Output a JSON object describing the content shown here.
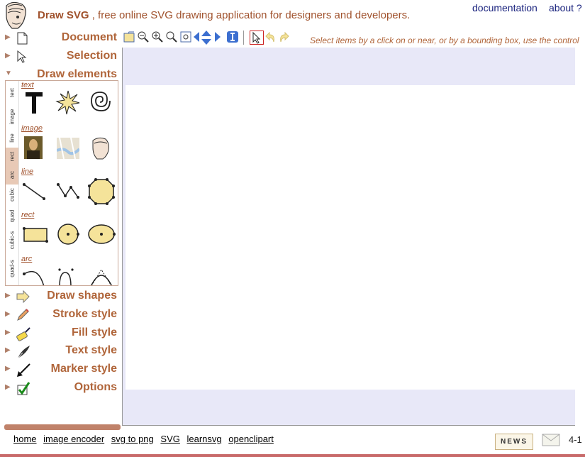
{
  "header": {
    "app_name": "Draw SVG",
    "tagline": ", free online SVG drawing application for designers and developers.",
    "links": [
      "documentation",
      "about ?"
    ]
  },
  "accordion": [
    {
      "label": "Document",
      "icon": "document-icon",
      "expanded": false
    },
    {
      "label": "Selection",
      "icon": "cursor-icon",
      "expanded": false
    },
    {
      "label": "Draw elements",
      "icon": "",
      "expanded": true
    },
    {
      "label": "Draw shapes",
      "icon": "arrow-shape-icon",
      "expanded": false
    },
    {
      "label": "Stroke style",
      "icon": "pencil-icon",
      "expanded": false
    },
    {
      "label": "Fill style",
      "icon": "paint-roller-icon",
      "expanded": false
    },
    {
      "label": "Text style",
      "icon": "quill-icon",
      "expanded": false
    },
    {
      "label": "Marker style",
      "icon": "marker-arrow-icon",
      "expanded": false
    },
    {
      "label": "Options",
      "icon": "checkbox-icon",
      "expanded": false
    }
  ],
  "draw_elements": {
    "vertical_tabs": [
      "text",
      "image",
      "line",
      "rect",
      "arc",
      "cubic",
      "quad",
      "cubic-s",
      "quad-s"
    ],
    "active_tab": "arc",
    "sections": [
      "text",
      "image",
      "line",
      "rect",
      "arc"
    ]
  },
  "toolbar": {
    "hint": "Select items by a click on or near, or by a bounding box, use the control"
  },
  "footer": {
    "links": [
      "home",
      "image encoder",
      "svg to png",
      "SVG",
      "learnsvg",
      "openclipart"
    ],
    "news": "NEWS",
    "pager": "4-1"
  },
  "colors": {
    "accent": "#b0653a",
    "workarea_bg": "#e8e8f8",
    "tool_fill": "#f5e39a",
    "footer_line": "#c86a6a"
  }
}
